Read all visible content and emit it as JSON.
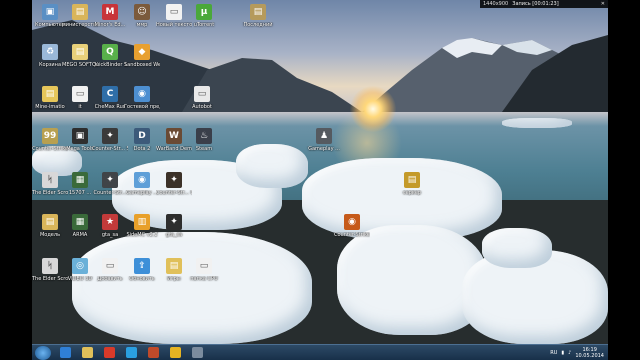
{
  "recording_bar": {
    "resolution": "1440x900",
    "status": "Запись [00:01:23]"
  },
  "icons": [
    {
      "label": "Компьютер",
      "color": "#5a8fc4",
      "glyph": "▣"
    },
    {
      "label": "министерство ярлыки",
      "color": "#d9b55a",
      "glyph": "▤"
    },
    {
      "label": "Minor's Ed...",
      "color": "#c8343a",
      "glyph": "M"
    },
    {
      "label": "ммр",
      "color": "#7b5a3c",
      "glyph": "☺"
    },
    {
      "label": "Новый текстовый...",
      "color": "#f2f2f2",
      "glyph": "▭"
    },
    {
      "label": "uTorrent",
      "color": "#4aa83a",
      "glyph": "µ"
    },
    {
      "label": "Последний",
      "color": "#b59a5c",
      "glyph": "▤"
    },
    {
      "label": "Корзина",
      "color": "#9ab8d8",
      "glyph": "♻"
    },
    {
      "label": "MEGO SOFT 3000",
      "color": "#e8d07a",
      "glyph": "▤"
    },
    {
      "label": "QuickBinder 1.7",
      "color": "#58b04a",
      "glyph": "Q"
    },
    {
      "label": "Sandboxed Web Browser",
      "color": "#e8a030",
      "glyph": "◆"
    },
    {
      "label": "Mine-imatio",
      "color": "#e6c65a",
      "glyph": "▤"
    },
    {
      "label": "it",
      "color": "#f1f1f1",
      "glyph": "▭"
    },
    {
      "label": "CheMax Rus",
      "color": "#2f6ea8",
      "glyph": "C"
    },
    {
      "label": "Гостевой предложения",
      "color": "#4d8fd1",
      "glyph": "◉"
    },
    {
      "label": "Autobot",
      "color": "#e9e9e9",
      "glyph": "▭"
    },
    {
      "label": "Counter-Strike",
      "color": "#b8a050",
      "glyph": "99"
    },
    {
      "label": "Mega Tools",
      "color": "#2e2e2e",
      "glyph": "▣"
    },
    {
      "label": "Counter-Str... Source",
      "color": "#3a3a3a",
      "glyph": "✦"
    },
    {
      "label": "Dota 2",
      "color": "#3c5a7a",
      "glyph": "D"
    },
    {
      "label": "WarBand Demo",
      "color": "#6a4a34",
      "glyph": "W"
    },
    {
      "label": "Steam",
      "color": "#3a3f4a",
      "glyph": "♨"
    },
    {
      "label": "Gameplay ...",
      "color": "#555a60",
      "glyph": "♟"
    },
    {
      "label": "The Elder Scrolls 5 S...",
      "color": "#d8d8d8",
      "glyph": "ᛋ"
    },
    {
      "label": "15707 ...",
      "color": "#3a6a3a",
      "glyph": "▦"
    },
    {
      "label": "Counter-Str...",
      "color": "#404448",
      "glyph": "✦"
    },
    {
      "label": "Gameplay ...",
      "color": "#5e9fd8",
      "glyph": "◉"
    },
    {
      "label": "Counter-Str... Global Off...",
      "color": "#3b3128",
      "glyph": "✦"
    },
    {
      "label": "сервер",
      "color": "#c49a2a",
      "glyph": "▤"
    },
    {
      "label": "Модель",
      "color": "#d9b55a",
      "glyph": "▤"
    },
    {
      "label": "ARMA",
      "color": "#3a6a3a",
      "glyph": "▦"
    },
    {
      "label": "gta_sa",
      "color": "#c23a3a",
      "glyph": "★"
    },
    {
      "label": "SideMC v2.2",
      "color": "#e8a02a",
      "glyph": "▥"
    },
    {
      "label": "gta_sa",
      "color": "#2d2d2d",
      "glyph": "✦"
    },
    {
      "label": "Counter-Strike Global Offe...",
      "color": "#c65a1a",
      "glyph": "◉"
    },
    {
      "label": "The Elder Scrolls 5 S...",
      "color": "#d8d8d8",
      "glyph": "ᛋ"
    },
    {
      "label": "VIDEO 3D",
      "color": "#6ab0d8",
      "glyph": "◎"
    },
    {
      "label": "Добавить",
      "color": "#f1f1f1",
      "glyph": "▭"
    },
    {
      "label": "Обновить",
      "color": "#3d8fd8",
      "glyph": "⇪"
    },
    {
      "label": "Игры",
      "color": "#e0c05a",
      "glyph": "▤"
    },
    {
      "label": "папка CPU",
      "color": "#f1f1f1",
      "glyph": "▭"
    }
  ],
  "taskbar": {
    "pinned": [
      {
        "name": "ie",
        "color": "#2f7fd6"
      },
      {
        "name": "explorer",
        "color": "#e0c05a"
      },
      {
        "name": "yandex",
        "color": "#d83a2a"
      },
      {
        "name": "skype",
        "color": "#2a9fe0"
      },
      {
        "name": "media",
        "color": "#c04a2a"
      },
      {
        "name": "chrome",
        "color": "#e6b422"
      },
      {
        "name": "window",
        "color": "#7b8c9e"
      }
    ],
    "lang": "RU",
    "time": "16:19",
    "date": "10.05.2014"
  }
}
